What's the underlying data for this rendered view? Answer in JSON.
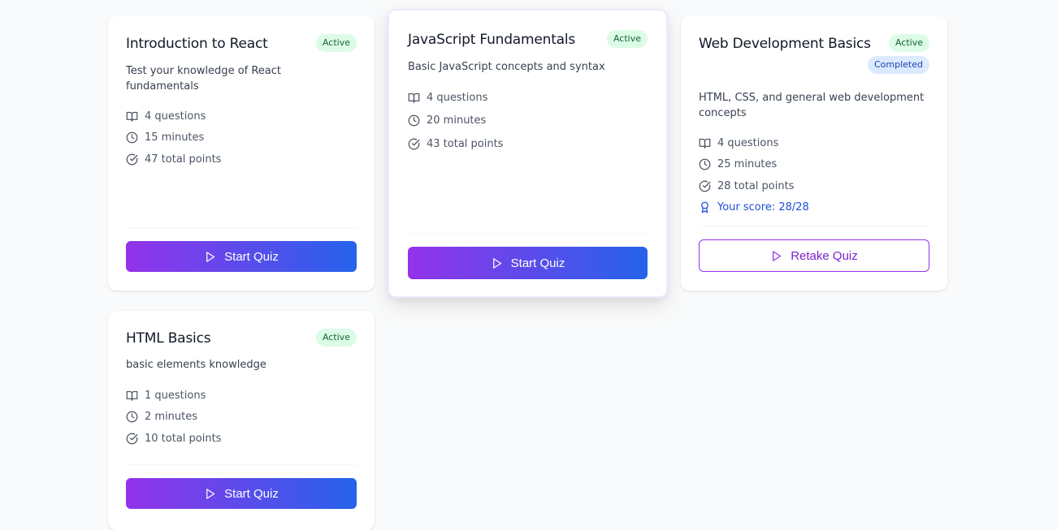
{
  "quizzes": [
    {
      "title": "Introduction to React",
      "status": "Active",
      "description": "Test your knowledge of React fundamentals",
      "questions": "4 questions",
      "duration": "15 minutes",
      "points": "47 total points",
      "button_label": "Start Quiz"
    },
    {
      "title": "JavaScript Fundamentals",
      "status": "Active",
      "description": "Basic JavaScript concepts and syntax",
      "questions": "4 questions",
      "duration": "20 minutes",
      "points": "43 total points",
      "button_label": "Start Quiz"
    },
    {
      "title": "Web Development Basics",
      "status": "Active",
      "completion": "Completed",
      "description": "HTML, CSS, and general web development concepts",
      "questions": "4 questions",
      "duration": "25 minutes",
      "points": "28 total points",
      "score": "Your score: 28/28",
      "button_label": "Retake Quiz"
    },
    {
      "title": "HTML Basics",
      "status": "Active",
      "description": "basic elements knowledge",
      "questions": "1 questions",
      "duration": "2 minutes",
      "points": "10 total points",
      "button_label": "Start Quiz"
    }
  ],
  "colors": {
    "page_bg": "#f9fafb",
    "gradient_start": "#9333ea",
    "gradient_end": "#2563eb",
    "active_badge_bg": "#dcfce7",
    "active_badge_text": "#166534",
    "completed_badge_bg": "#dbeafe",
    "completed_badge_text": "#1e40af",
    "score_text": "#1d4ed8"
  },
  "icons": {
    "questions": "book-open-icon",
    "duration": "clock-icon",
    "points": "check-circle-icon",
    "score": "award-icon",
    "button": "play-icon"
  }
}
